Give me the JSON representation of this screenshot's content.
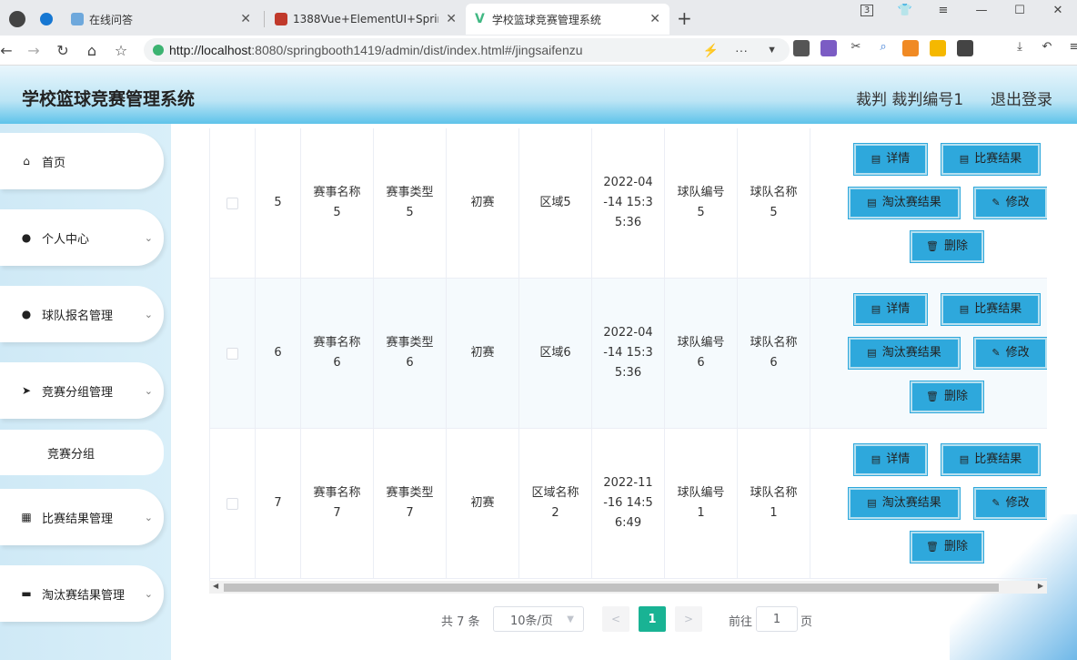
{
  "browser": {
    "tabs": [
      {
        "title": "在线问答"
      },
      {
        "title": "1388Vue+ElementUI+Sprinc"
      },
      {
        "title": "学校篮球竞赛管理系统"
      }
    ],
    "tab_counter": "3",
    "url_host": "http://localhost",
    "url_rest": ":8080/springbooth1419/admin/dist/index.html#/jingsaifenzu"
  },
  "header": {
    "title": "学校篮球竞赛管理系统",
    "user": "裁判 裁判编号1",
    "logout": "退出登录"
  },
  "sidebar": {
    "items": [
      {
        "label": "首页",
        "icon": "home-icon"
      },
      {
        "label": "个人中心",
        "icon": "user-icon"
      },
      {
        "label": "球队报名管理",
        "icon": "user-icon"
      },
      {
        "label": "竞赛分组管理",
        "icon": "send-icon"
      },
      {
        "label": "竞赛分组",
        "icon": ""
      },
      {
        "label": "比赛结果管理",
        "icon": "grid-icon"
      },
      {
        "label": "淘汰赛结果管理",
        "icon": "briefcase-icon"
      }
    ]
  },
  "table": {
    "rows": [
      {
        "index": "5",
        "name": "赛事名称\n5",
        "type": "赛事类型\n5",
        "round": "初赛",
        "area": "区域5",
        "time": "2022-04\n-14 15:3\n5:36",
        "team_no": "球队编号\n5",
        "team_name": "球队名称\n5"
      },
      {
        "index": "6",
        "name": "赛事名称\n6",
        "type": "赛事类型\n6",
        "round": "初赛",
        "area": "区域6",
        "time": "2022-04\n-14 15:3\n5:36",
        "team_no": "球队编号\n6",
        "team_name": "球队名称\n6"
      },
      {
        "index": "7",
        "name": "赛事名称\n7",
        "type": "赛事类型\n7",
        "round": "初赛",
        "area": "区域名称\n2",
        "time": "2022-11\n-16 14:5\n6:49",
        "team_no": "球队编号\n1",
        "team_name": "球队名称\n1"
      }
    ],
    "actions": {
      "detail": "详情",
      "result": "比赛结果",
      "knockout": "淘汰赛结果",
      "edit": "修改",
      "delete": "删除"
    }
  },
  "pagination": {
    "total": "共 7 条",
    "page_size": "10条/页",
    "current": "1",
    "goto": "前往",
    "goto_value": "1",
    "unit": "页"
  }
}
